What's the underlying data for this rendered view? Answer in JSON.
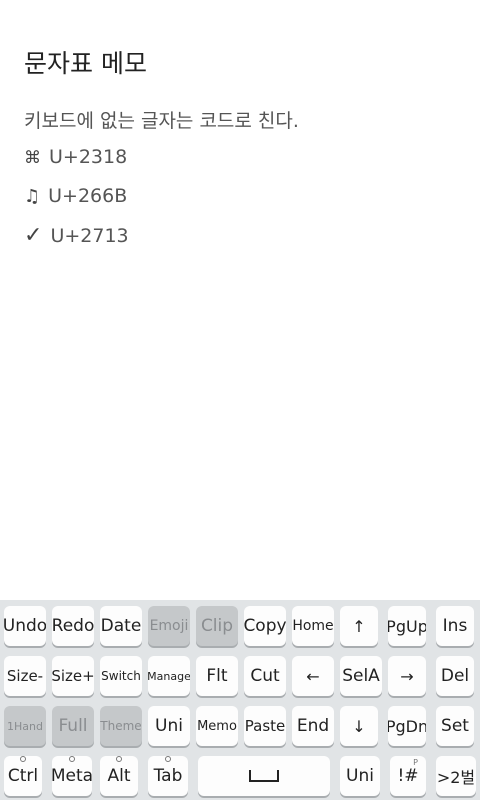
{
  "note": {
    "title": "문자표 메모",
    "subtitle": "키보드에 없는 글자는 코드로 친다.",
    "entries": [
      {
        "glyph": "⌘",
        "code": "U+2318"
      },
      {
        "glyph": "♫",
        "code": "U+266B"
      },
      {
        "glyph": "✓",
        "code": "U+2713"
      }
    ]
  },
  "keyboard": {
    "row1": [
      "Undo",
      "Redo",
      "Date",
      "Emoji",
      "Clip",
      "Copy",
      "Home",
      "↑",
      "PgUp",
      "Ins"
    ],
    "row2": [
      "Size-",
      "Size+",
      "Switch",
      "Manage",
      "Flt",
      "Cut",
      "←",
      "SelA",
      "→",
      "Del"
    ],
    "row3": [
      "1Hand",
      "Full",
      "Theme",
      "Uni",
      "Memo",
      "Paste",
      "End",
      "↓",
      "PgDn",
      "Set"
    ],
    "row4": [
      "Ctrl",
      "Meta",
      "Alt",
      "Tab",
      "Uni",
      "!#",
      ">2벌"
    ],
    "sym_hint": "P"
  },
  "colors": {
    "keyboard_bg": "#e1e4e6",
    "key_bg": "#fdfdfd",
    "key_dim_bg": "#c5c8ca"
  }
}
